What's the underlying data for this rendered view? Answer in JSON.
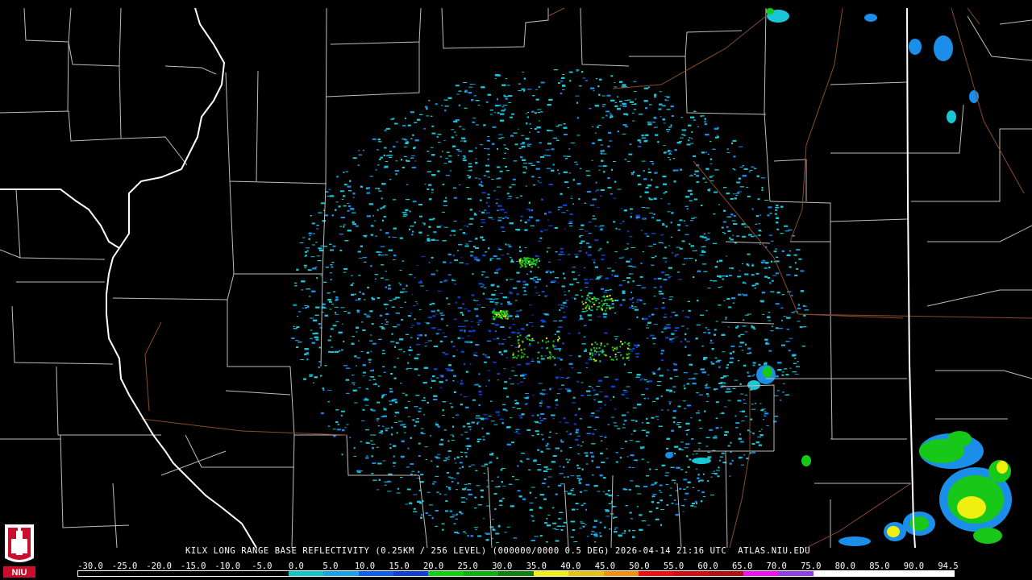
{
  "caption": {
    "text": "KILX LONG RANGE BASE REFLECTIVITY (0.25KM / 256 LEVEL) (000000/0000 0.5 DEG) 2026-04-14 21:16 UTC  ATLAS.NIU.EDU"
  },
  "logo": {
    "text": "NIU",
    "colors": {
      "red": "#c8102e",
      "white": "#ffffff"
    }
  },
  "scale": {
    "labels": [
      "-30.0",
      "-25.0",
      "-20.0",
      "-15.0",
      "-10.0",
      "-5.0",
      "0.0",
      "5.0",
      "10.0",
      "15.0",
      "20.0",
      "25.0",
      "30.0",
      "35.0",
      "40.0",
      "45.0",
      "50.0",
      "55.0",
      "60.0",
      "65.0",
      "70.0",
      "75.0",
      "80.0",
      "85.0",
      "90.0",
      "94.5"
    ],
    "colors": [
      "#000000",
      "#000000",
      "#000000",
      "#000000",
      "#000000",
      "#000000",
      "#11c7c7",
      "#1aa3e8",
      "#1060f0",
      "#1040d8",
      "#10d010",
      "#10b010",
      "#108010",
      "#f0f010",
      "#e8c010",
      "#f09010",
      "#f01010",
      "#d01010",
      "#b01010",
      "#f010f0",
      "#9040e0",
      "#ffffff",
      "#ffffff",
      "#ffffff",
      "#ffffff"
    ]
  },
  "map_colors": {
    "background": "#000000",
    "county_lines": "#c8c8c8",
    "state_lines": "#ffffff",
    "roads": "#8a4a2a",
    "echo_light": "#19c6d6",
    "echo_mid": "#1a8ee8",
    "echo_dark": "#1040d0",
    "echo_green": "#18c818",
    "echo_yellow": "#f0f010"
  }
}
